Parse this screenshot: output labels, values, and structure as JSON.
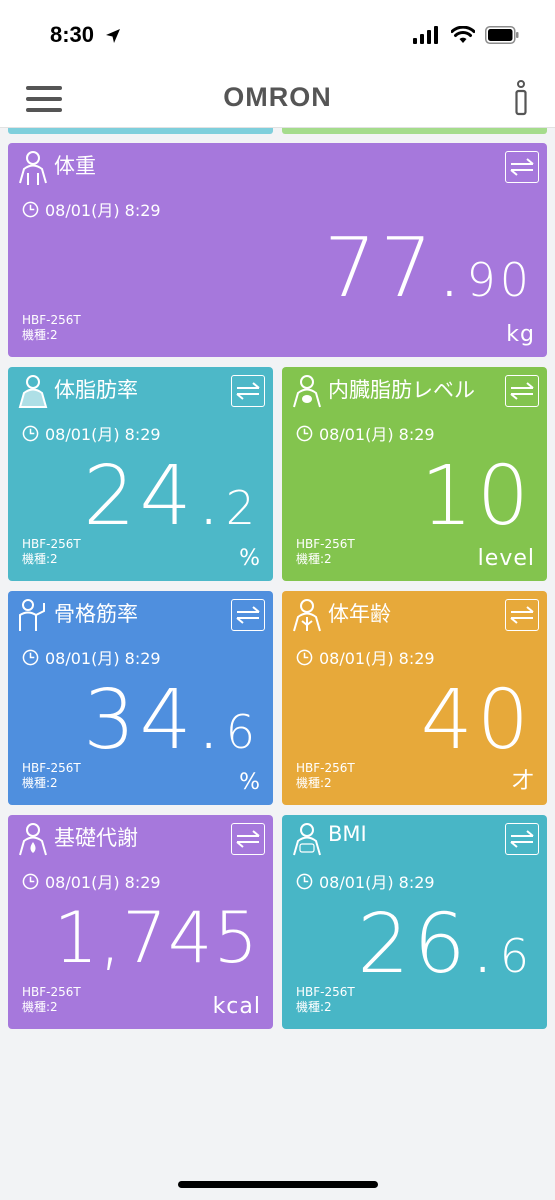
{
  "status": {
    "time": "8:30"
  },
  "nav": {
    "logo": "OMRON"
  },
  "cards": [
    {
      "title": "体重",
      "time": "08/01(月) 8:29",
      "value_int": "77.",
      "value_dec": "90",
      "unit": "kg",
      "model": "HBF-256T",
      "type_label": "機種:2",
      "color": "#a678dc"
    },
    {
      "title": "体脂肪率",
      "time": "08/01(月) 8:29",
      "value_int": "24.",
      "value_dec": "2",
      "unit": "%",
      "model": "HBF-256T",
      "type_label": "機種:2",
      "color": "#4db8c8"
    },
    {
      "title": "内臓脂肪レベル",
      "time": "08/01(月) 8:29",
      "value_int": "10",
      "value_dec": "",
      "unit": "level",
      "model": "HBF-256T",
      "type_label": "機種:2",
      "color": "#83c44e"
    },
    {
      "title": "骨格筋率",
      "time": "08/01(月) 8:29",
      "value_int": "34.",
      "value_dec": "6",
      "unit": "%",
      "model": "HBF-256T",
      "type_label": "機種:2",
      "color": "#4f8fde"
    },
    {
      "title": "体年齢",
      "time": "08/01(月) 8:29",
      "value_int": "40",
      "value_dec": "",
      "unit": "才",
      "model": "HBF-256T",
      "type_label": "機種:2",
      "color": "#e7a93a"
    },
    {
      "title": "基礎代謝",
      "time": "08/01(月) 8:29",
      "value_int": "1,745",
      "value_dec": "",
      "unit": "kcal",
      "model": "HBF-256T",
      "type_label": "機種:2",
      "color": "#a678dc"
    },
    {
      "title": "BMI",
      "time": "08/01(月) 8:29",
      "value_int": "26.",
      "value_dec": "6",
      "unit": "",
      "model": "HBF-256T",
      "type_label": "機種:2",
      "color": "#48b6c6"
    }
  ]
}
